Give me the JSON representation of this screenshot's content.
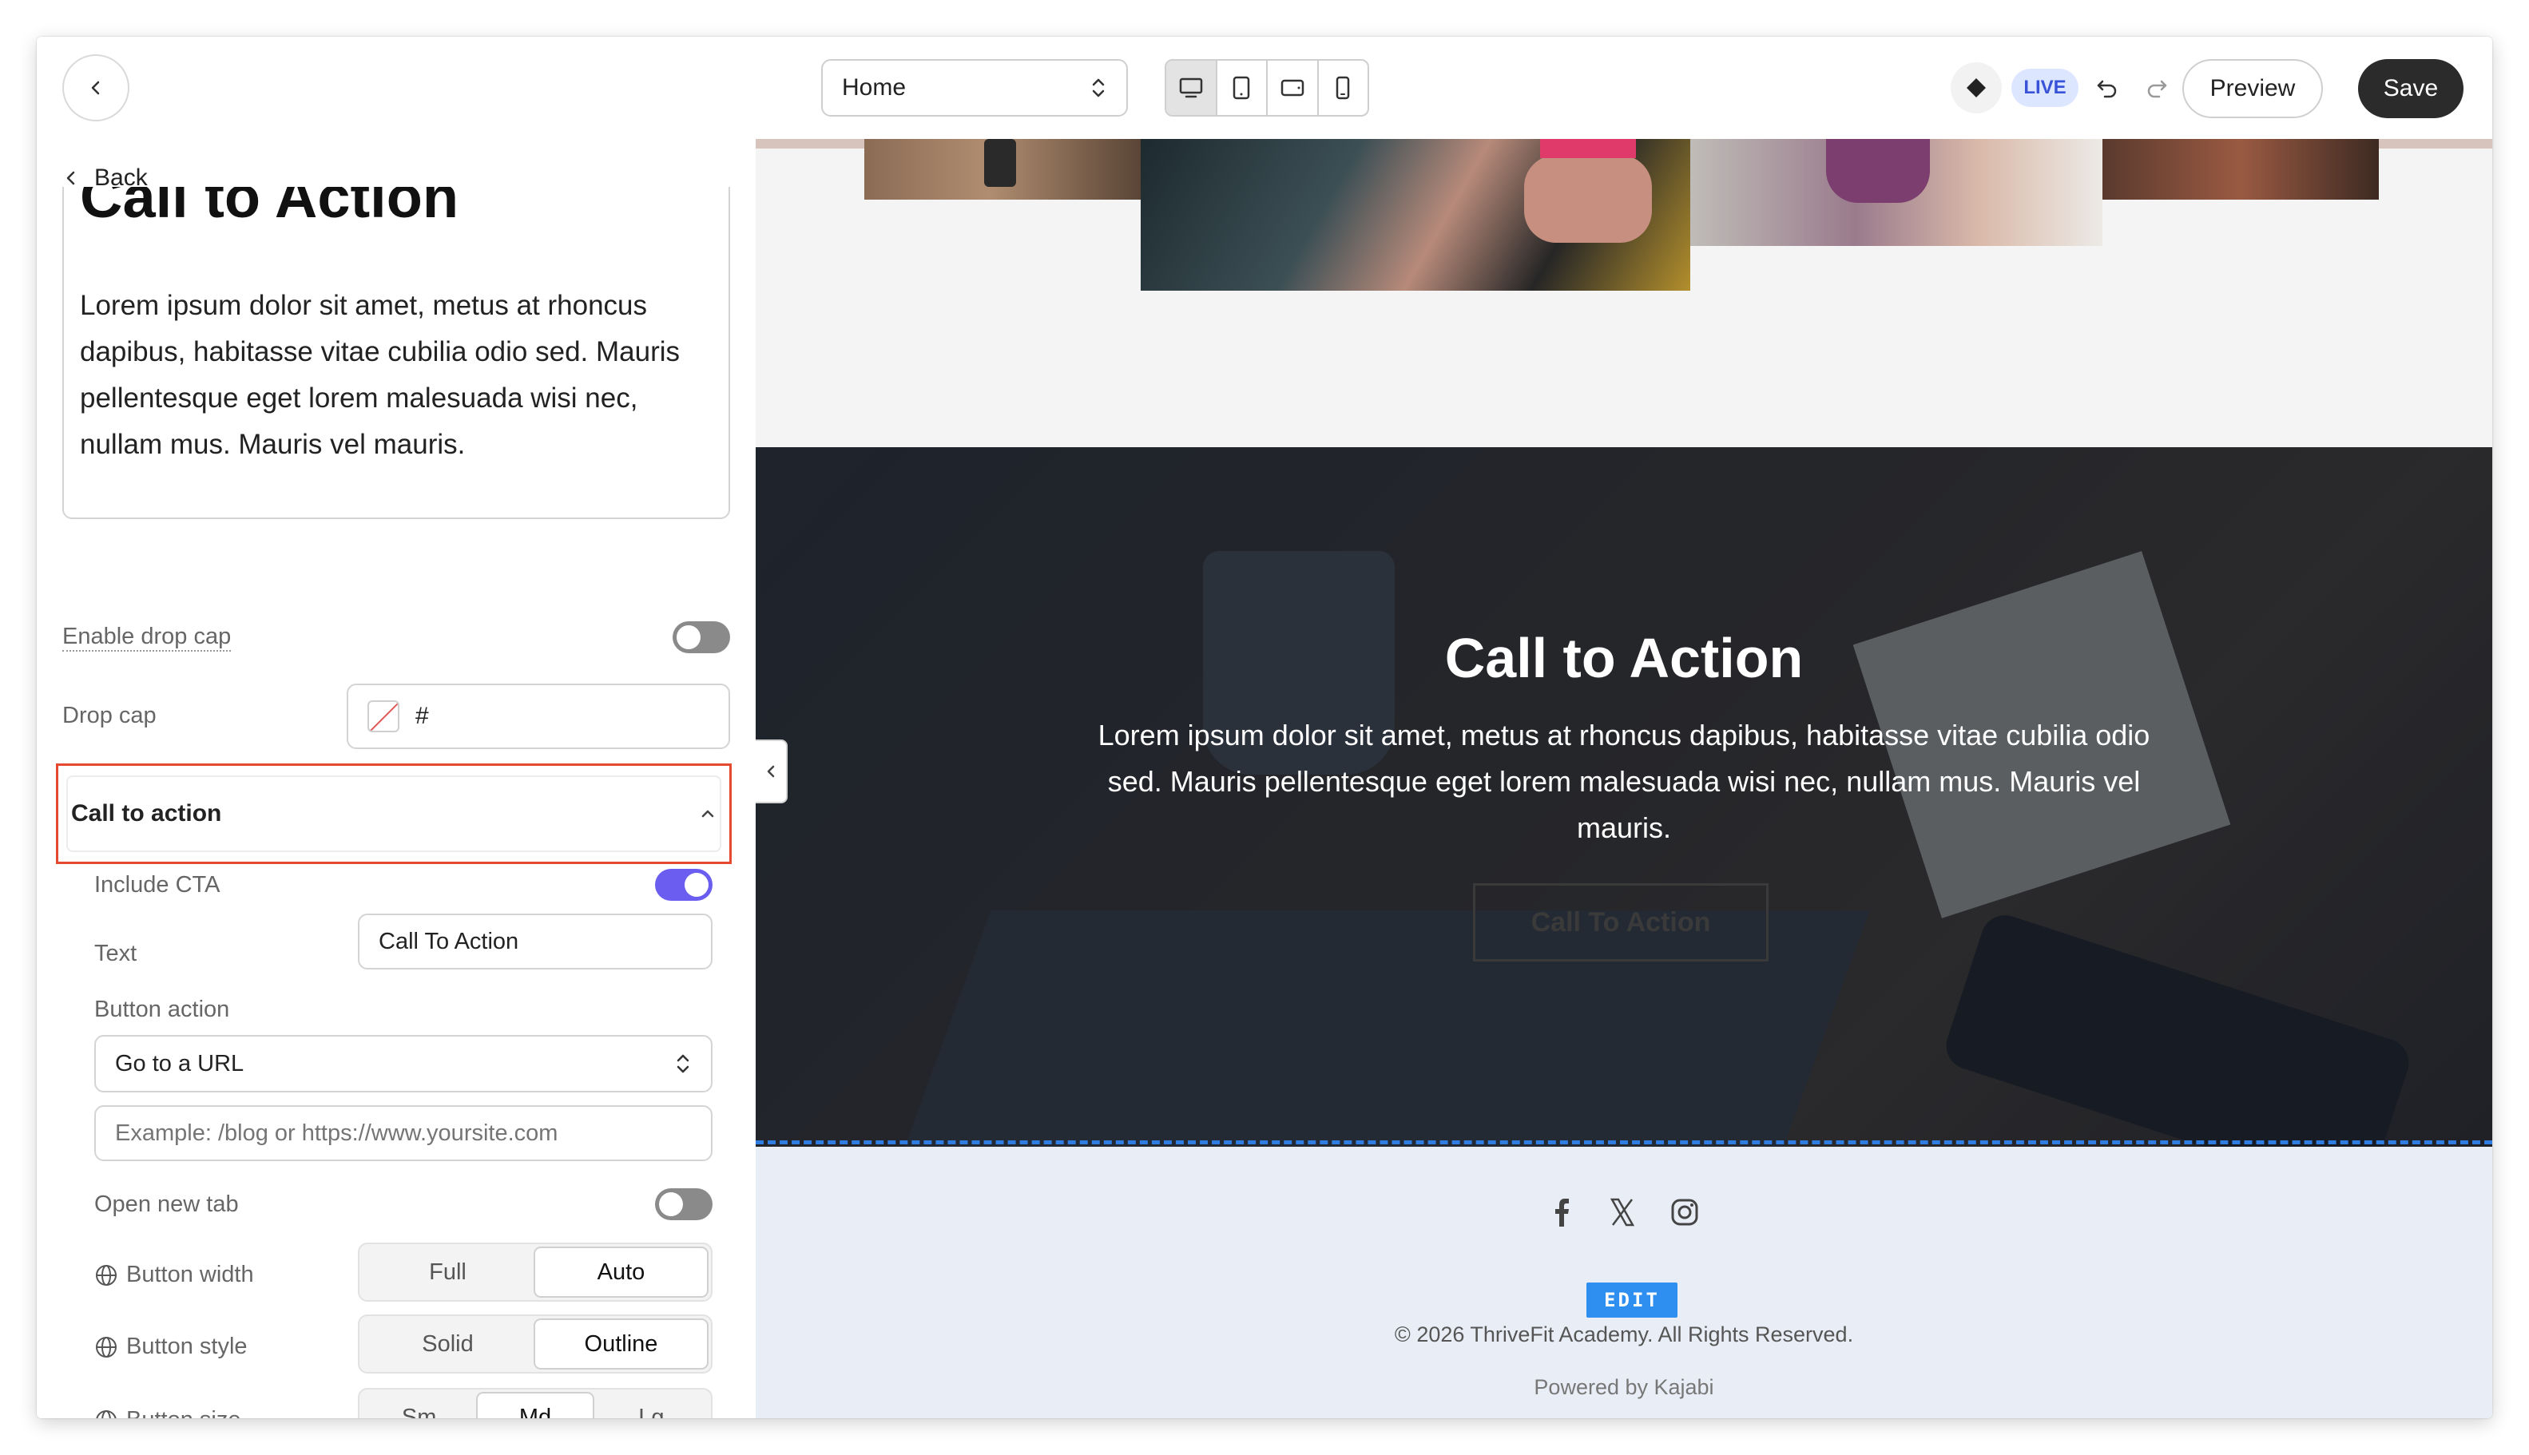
{
  "topbar": {
    "page_select": "Home",
    "live_badge": "LIVE",
    "preview_label": "Preview",
    "save_label": "Save"
  },
  "sidebar": {
    "back_label": "Back",
    "rte_title": "Call to Action",
    "rte_body": "Lorem ipsum dolor sit amet, metus at rhoncus dapibus, habitasse vitae cubilia odio sed. Mauris pellentesque eget lorem malesuada wisi nec, nullam mus. Mauris vel mauris.",
    "drop_cap_toggle_label": "Enable drop cap",
    "drop_cap_label": "Drop cap",
    "drop_cap_value": "#",
    "cta_section_label": "Call to action",
    "include_cta_label": "Include CTA",
    "text_label": "Text",
    "text_value": "Call To Action",
    "button_action_label": "Button action",
    "button_action_value": "Go to a URL",
    "url_placeholder": "Example: /blog or https://www.yoursite.com",
    "open_new_tab_label": "Open new tab",
    "button_width_label": "Button width",
    "button_width_options": [
      "Full",
      "Auto"
    ],
    "button_style_label": "Button style",
    "button_style_options": [
      "Solid",
      "Outline"
    ],
    "button_size_label": "Button size",
    "button_size_options": [
      "Sm",
      "Md",
      "Lg"
    ]
  },
  "toggles": {
    "drop_cap": false,
    "include_cta": true,
    "open_new_tab": false
  },
  "selected": {
    "button_width": "Auto",
    "button_style": "Outline",
    "button_size": "Md"
  },
  "preview": {
    "hero_title": "Call to Action",
    "hero_body": "Lorem ipsum dolor sit amet, metus at rhoncus dapibus, habitasse vitae cubilia odio sed. Mauris pellentesque eget lorem malesuada wisi nec, nullam mus. Mauris vel mauris.",
    "hero_button": "Call To Action",
    "edit_badge": "EDIT",
    "copyright": "© 2026 ThriveFit Academy. All Rights Reserved.",
    "powered_by": "Powered by Kajabi"
  },
  "icons": [
    "chevron-left-icon",
    "chevron-up-down-icon",
    "desktop-icon",
    "tablet-icon",
    "tablet-landscape-icon",
    "mobile-icon",
    "theme-diamond-icon",
    "undo-icon",
    "redo-icon",
    "chevron-up-icon",
    "globe-icon",
    "facebook-icon",
    "x-icon",
    "instagram-icon"
  ],
  "colors": {
    "accent_toggle": "#6b5df0",
    "highlight_border": "#e5492f",
    "live_badge_bg": "#dce6ff",
    "edit_badge": "#2f8ff0"
  }
}
